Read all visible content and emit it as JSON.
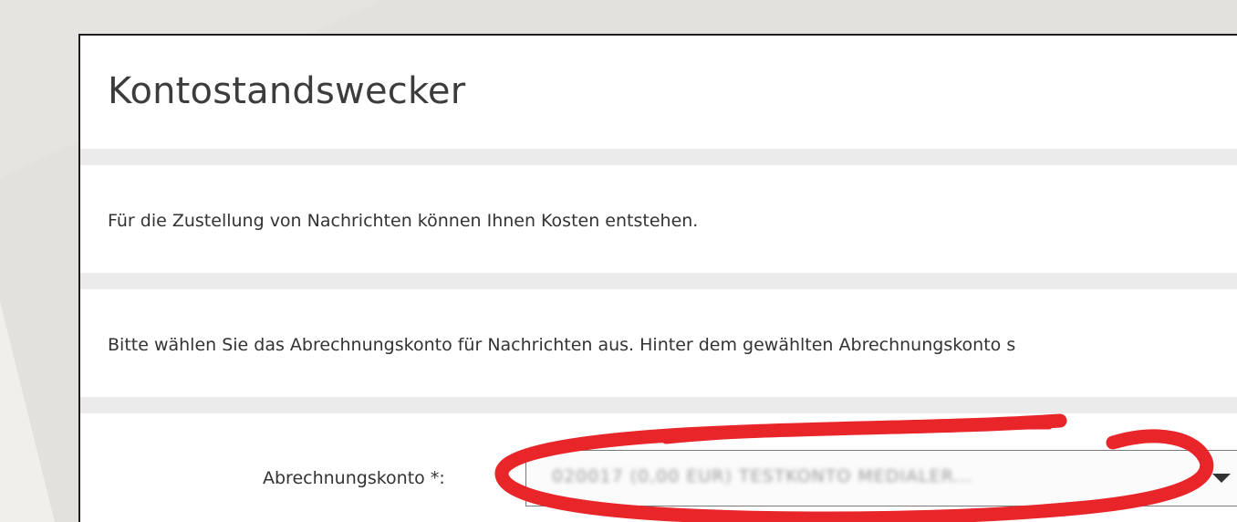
{
  "page": {
    "title": "Kontostandswecker",
    "cost_notice": "Für die Zustellung von Nachrichten können Ihnen Kosten entstehen.",
    "instruction": "Bitte wählen Sie das Abrechnungskonto für Nachrichten aus. Hinter dem gewählten Abrechnungskonto s"
  },
  "form": {
    "account_label": "Abrechnungskonto *:",
    "account_value": "020017 (0,00 EUR) TESTKONTO MEDIALER..."
  },
  "icons": {
    "dropdown": "chevron-down-icon",
    "annotation": "red-ellipse-highlight"
  },
  "colors": {
    "backdrop": "#e3e1dd",
    "panel": "#ffffff",
    "divider": "#ebebeb",
    "highlight": "#e8262a"
  }
}
